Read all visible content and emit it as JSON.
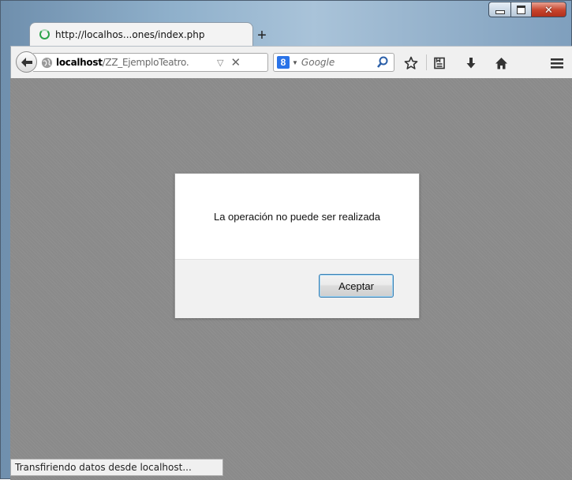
{
  "tab": {
    "title": "http://localhos...ones/index.php"
  },
  "navbar": {
    "url_host": "localhost",
    "url_path": "/ZZ_EjemploTeatro.",
    "search_placeholder": "Google",
    "search_engine_glyph": "8"
  },
  "dialog": {
    "message": "La operación no puede ser realizada",
    "accept_label": "Aceptar"
  },
  "status": {
    "text": "Transfiriendo datos desde localhost..."
  },
  "icons": {
    "back": "back-arrow-icon",
    "site": "globe-icon",
    "dropmarker": "dropdown-triangle-icon",
    "stop": "close-x-icon",
    "search": "search-icon",
    "bookmark": "star-icon",
    "bookmarks_menu": "bookmarks-list-icon",
    "download": "download-arrow-icon",
    "home": "home-icon",
    "menu": "hamburger-menu-icon"
  },
  "colors": {
    "page_overlay": "#8a8a8a",
    "dialog_bg": "#ffffff",
    "dialog_footer": "#f1f1f1",
    "button_border": "#3c7fb1",
    "loading": "#2da34a",
    "close_button": "#c7432b"
  }
}
